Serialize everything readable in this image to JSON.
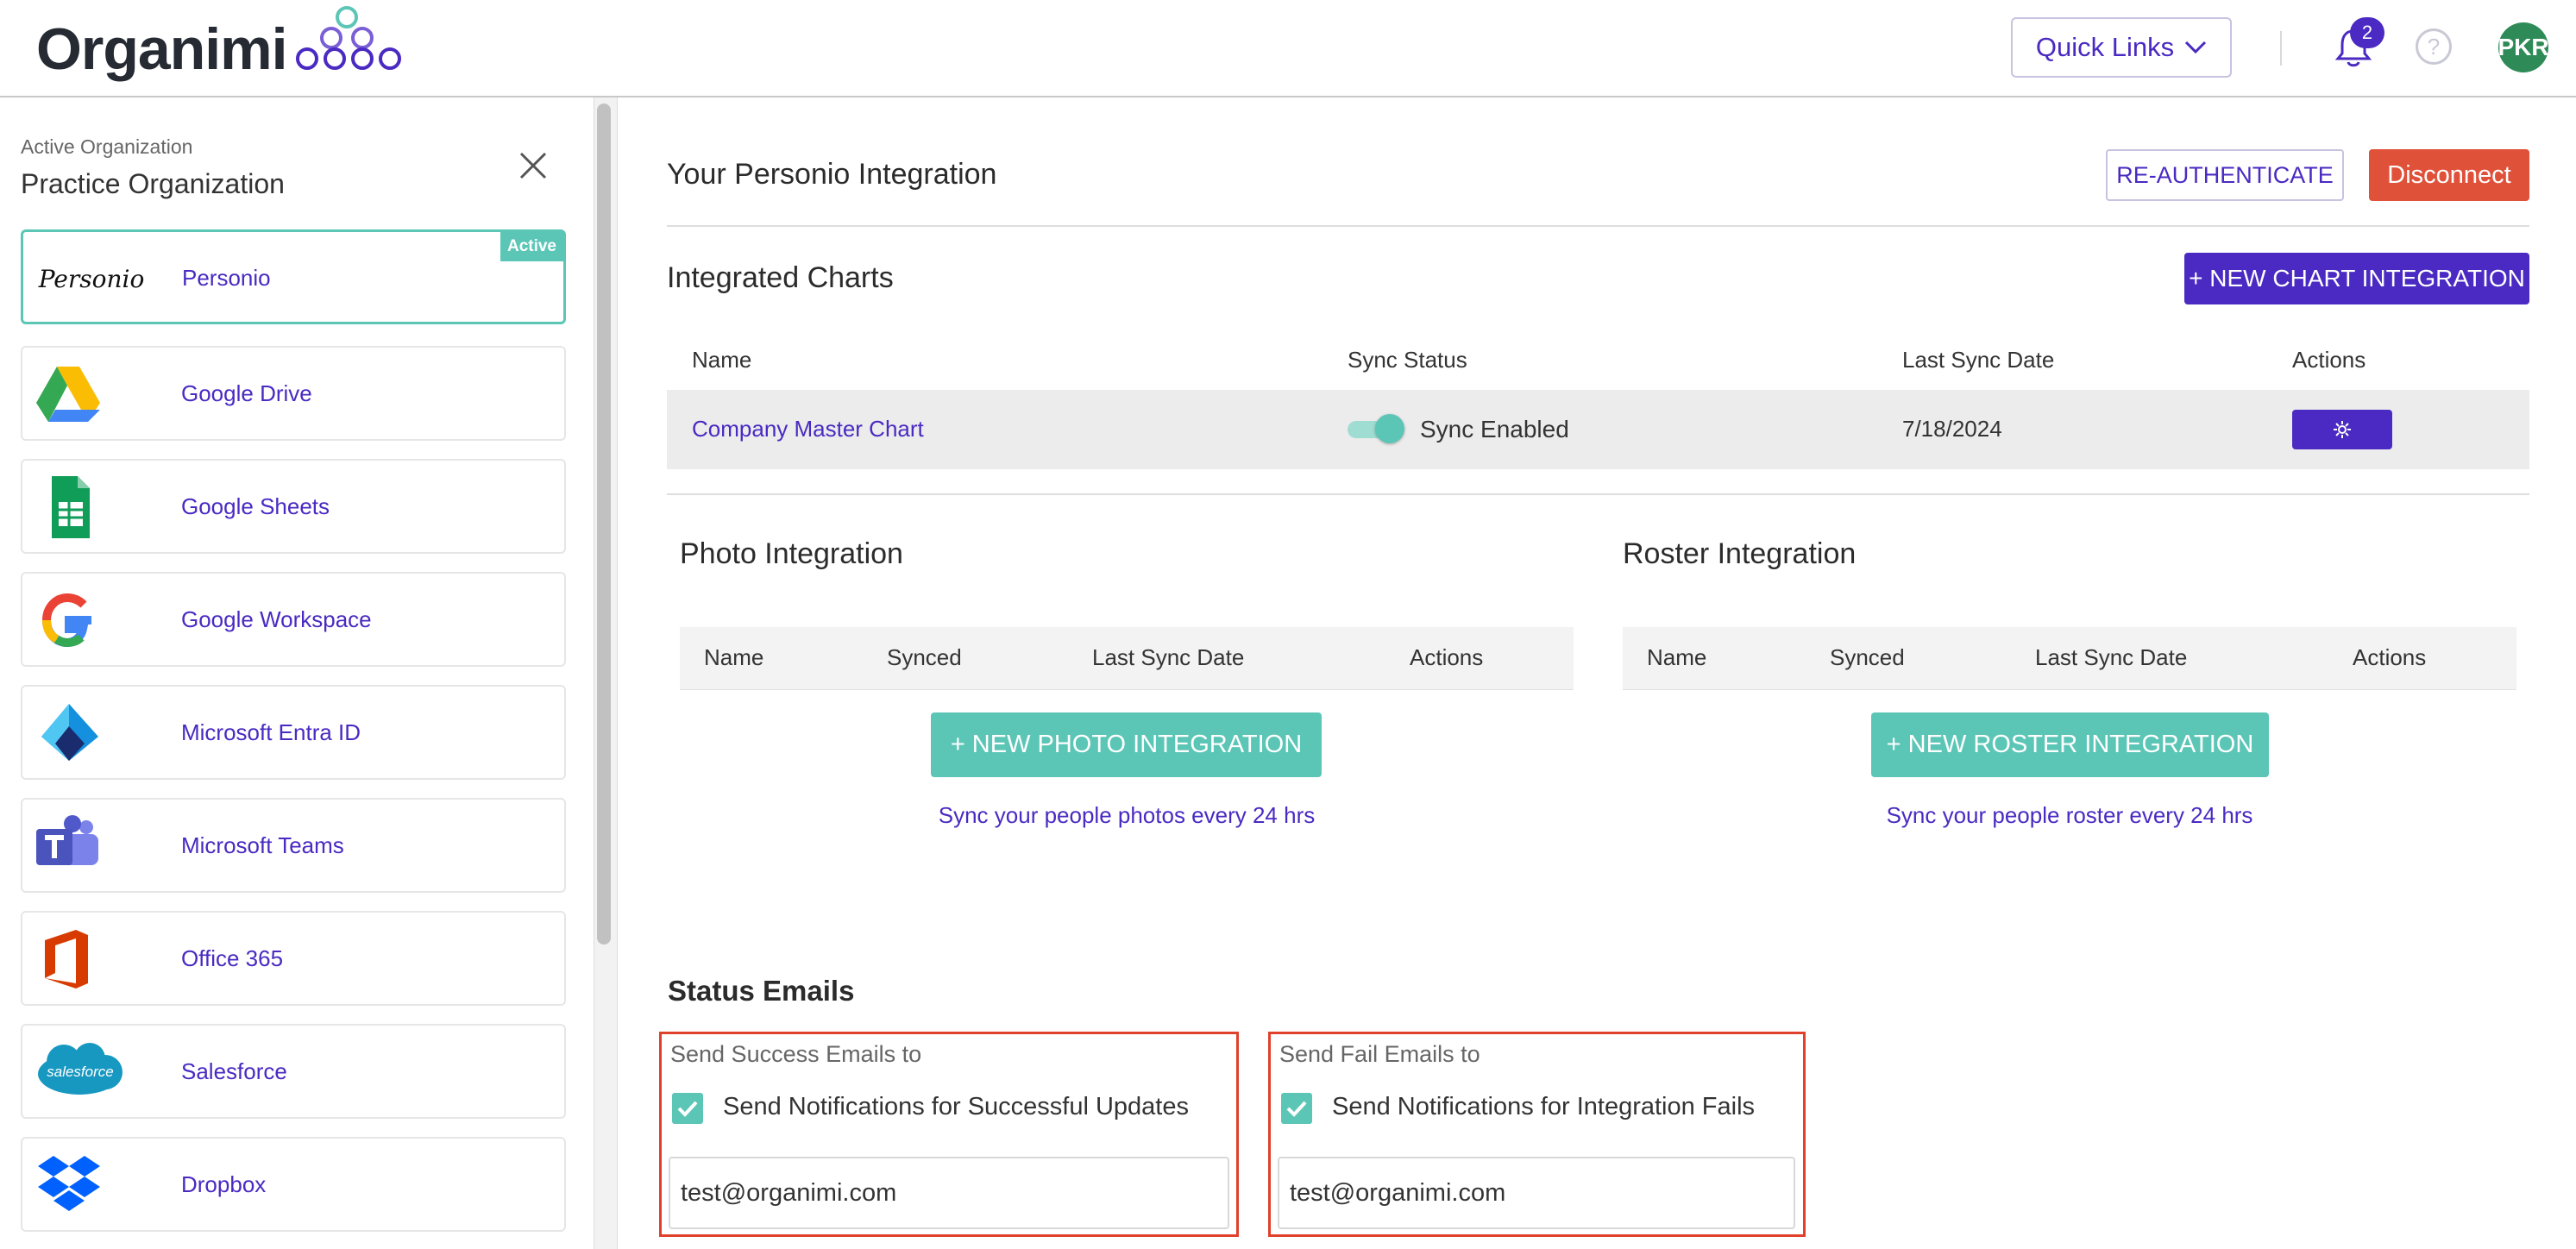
{
  "header": {
    "logo_text": "Organimi",
    "quick_links_label": "Quick Links",
    "notification_count": "2",
    "help_icon": "?",
    "avatar_initials": "PKR"
  },
  "sidebar": {
    "active_org_label": "Active Organization",
    "org_name": "Practice Organization",
    "active_tag": "Active",
    "items": [
      {
        "label": "Personio",
        "icon": "personio-logo"
      },
      {
        "label": "Google Drive",
        "icon": "google-drive-icon"
      },
      {
        "label": "Google Sheets",
        "icon": "google-sheets-icon"
      },
      {
        "label": "Google Workspace",
        "icon": "google-workspace-icon"
      },
      {
        "label": "Microsoft Entra ID",
        "icon": "microsoft-entra-icon"
      },
      {
        "label": "Microsoft Teams",
        "icon": "microsoft-teams-icon"
      },
      {
        "label": "Office 365",
        "icon": "office-365-icon"
      },
      {
        "label": "Salesforce",
        "icon": "salesforce-icon"
      },
      {
        "label": "Dropbox",
        "icon": "dropbox-icon"
      }
    ],
    "personio_logo_text": "Personio",
    "salesforce_logo_text": "salesforce"
  },
  "main": {
    "integration_title": "Your Personio Integration",
    "reauth_label": "RE-AUTHENTICATE",
    "disconnect_label": "Disconnect",
    "integrated_charts_title": "Integrated Charts",
    "new_chart_label": "+ NEW CHART INTEGRATION",
    "charts_table": {
      "headers": [
        "Name",
        "Sync Status",
        "Last Sync Date",
        "Actions"
      ],
      "rows": [
        {
          "name": "Company Master Chart",
          "sync_status": "Sync Enabled",
          "last_sync": "7/18/2024"
        }
      ]
    },
    "photo": {
      "title": "Photo Integration",
      "headers": [
        "Name",
        "Synced",
        "Last Sync Date",
        "Actions"
      ],
      "new_label": "+ NEW PHOTO INTEGRATION",
      "hint": "Sync your people photos every 24 hrs"
    },
    "roster": {
      "title": "Roster Integration",
      "headers": [
        "Name",
        "Synced",
        "Last Sync Date",
        "Actions"
      ],
      "new_label": "+ NEW ROSTER INTEGRATION",
      "hint": "Sync your people roster every 24 hrs"
    },
    "status_emails": {
      "title": "Status Emails",
      "success": {
        "label": "Send Success Emails to",
        "checkbox_label": "Send Notifications for Successful Updates",
        "email": "test@organimi.com"
      },
      "fail": {
        "label": "Send Fail Emails to",
        "checkbox_label": "Send Notifications for Integration Fails",
        "email": "test@organimi.com"
      }
    }
  },
  "colors": {
    "accent_purple": "#4a2ac2",
    "teal": "#5cc6b6",
    "red": "#e0513a"
  }
}
